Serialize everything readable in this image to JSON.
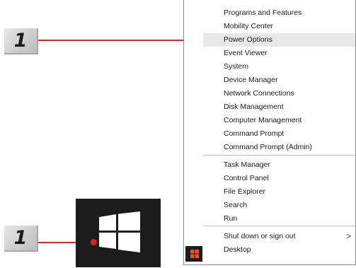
{
  "badges": {
    "top_number": "1",
    "bottom_number": "1"
  },
  "colors": {
    "callout": "#e02020",
    "tile_bg": "#1c1c1c",
    "windows_logo_large": "#ffffff",
    "windows_logo_small": "#f25022",
    "highlight_bg": "#e8e8e8"
  },
  "icons": {
    "start_tile": "windows-logo-icon",
    "taskbar_start": "windows-logo-icon",
    "submenu": "chevron-right-icon"
  },
  "menu": {
    "items": [
      "Programs and Features",
      "Mobility Center",
      "Power Options",
      "Event Viewer",
      "System",
      "Device Manager",
      "Network Connections",
      "Disk Management",
      "Computer Management",
      "Command Prompt",
      "Command Prompt (Admin)",
      "Task Manager",
      "Control Panel",
      "File Explorer",
      "Search",
      "Run",
      "Shut down or sign out",
      "Desktop"
    ],
    "highlighted": "Power Options",
    "submenu_glyph": ">"
  }
}
